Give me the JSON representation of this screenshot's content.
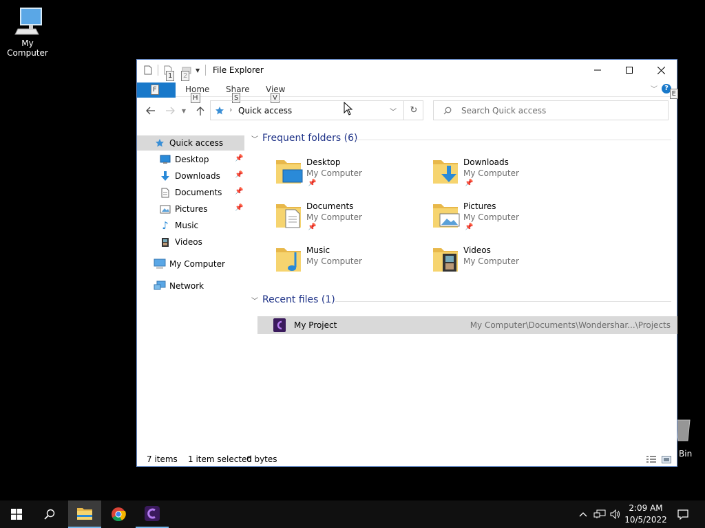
{
  "desktop": {
    "my_computer_label": "My Computer",
    "recycle_bin_label": "Bin"
  },
  "window": {
    "title": "File Explorer",
    "keytips": {
      "qat1": "1",
      "qat2": "2",
      "file": "F",
      "home": "H",
      "share": "S",
      "view": "V",
      "help": "E"
    },
    "ribbon_tabs": [
      "Home",
      "Share",
      "View"
    ],
    "help_label": "?"
  },
  "addressbar": {
    "path": "Quick access",
    "separator": "›"
  },
  "search": {
    "placeholder": "Search Quick access"
  },
  "navpane": {
    "quick_access": "Quick access",
    "pinned": [
      "Desktop",
      "Downloads",
      "Documents",
      "Pictures"
    ],
    "unpinned": [
      "Music",
      "Videos"
    ],
    "my_computer": "My Computer",
    "network": "Network"
  },
  "content": {
    "frequent_header": "Frequent folders (6)",
    "recent_header": "Recent files (1)",
    "folders": [
      {
        "name": "Desktop",
        "location": "My Computer"
      },
      {
        "name": "Downloads",
        "location": "My Computer"
      },
      {
        "name": "Documents",
        "location": "My Computer"
      },
      {
        "name": "Pictures",
        "location": "My Computer"
      },
      {
        "name": "Music",
        "location": "My Computer"
      },
      {
        "name": "Videos",
        "location": "My Computer"
      }
    ],
    "recent": [
      {
        "name": "My Project",
        "path": "My Computer\\Documents\\Wondershar...\\Projects"
      }
    ]
  },
  "statusbar": {
    "items": "7 items",
    "selected": "1 item selected",
    "size": "0 bytes"
  },
  "taskbar": {
    "time": "2:09 AM",
    "date": "10/5/2022"
  },
  "colors": {
    "accent": "#1979ca",
    "selection": "#d9d9d9",
    "taskbar": "#101010",
    "group_header": "#1e3287"
  }
}
